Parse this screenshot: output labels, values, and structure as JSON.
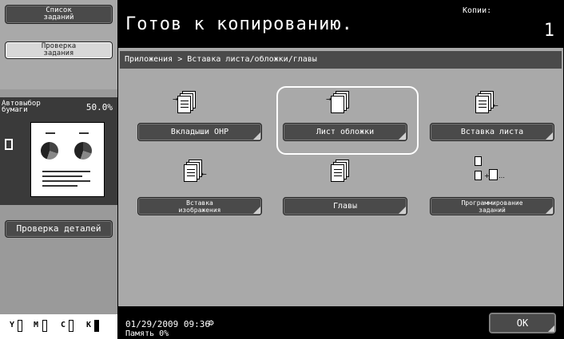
{
  "left_panel": {
    "job_list_label": "Список\nзаданий",
    "job_check_label": "Проверка\nзадания",
    "auto_paper_label": "Автовыбор\nбумаги",
    "zoom_value": "50.0%",
    "detail_check_label": "Проверка деталей",
    "toner": [
      "Y",
      "M",
      "C",
      "K"
    ]
  },
  "header": {
    "title": "Готов к копированию.",
    "copies_label": "Копии:",
    "copies_value": "1"
  },
  "breadcrumb": "Приложения > Вставка листа/обложки/главы",
  "functions": [
    {
      "label": "Вкладыши OHP",
      "icon": "ohp-interleave-icon"
    },
    {
      "label": "Лист обложки",
      "icon": "cover-sheet-icon"
    },
    {
      "label": "Вставка листа",
      "icon": "insert-sheet-icon"
    },
    {
      "label": "Вставка\nизображения",
      "icon": "insert-image-icon"
    },
    {
      "label": "Главы",
      "icon": "chapters-icon"
    },
    {
      "label": "Программирование\nзаданий",
      "icon": "job-program-icon"
    }
  ],
  "footer": {
    "date_time": "01/29/2009   09:36",
    "memory": "Память       0%",
    "ok_label": "OK"
  },
  "colors": {
    "screen_bg": "#000000",
    "panel_gray": "#a9a9a9",
    "button_dark": "#4a4a4a"
  }
}
